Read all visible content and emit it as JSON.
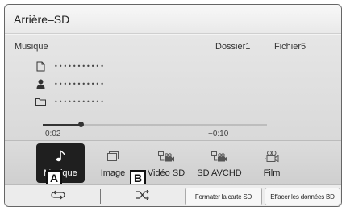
{
  "header": {
    "title": "Arrière–SD"
  },
  "track_info": {
    "source_label": "Musique",
    "folder_label": "Dossier1",
    "file_label": "Fichier5",
    "song_title": "•••••••••••",
    "artist": "•••••••••••",
    "album": "•••••••••••"
  },
  "playback": {
    "elapsed": "0:02",
    "remaining": "−0:10",
    "progress_fraction": 0.17
  },
  "source_buttons": [
    {
      "label": "Musique",
      "icon": "music-note-icon",
      "active": true
    },
    {
      "label": "Image",
      "icon": "image-icon",
      "active": false
    },
    {
      "label": "Vidéo SD",
      "icon": "video-icon",
      "active": false
    },
    {
      "label": "SD AVCHD",
      "icon": "video-icon",
      "active": false
    },
    {
      "label": "Film",
      "icon": "film-icon",
      "active": false
    }
  ],
  "callouts": {
    "a": "A",
    "b": "B"
  },
  "controls": {
    "repeat_icon": "repeat-icon",
    "shuffle_icon": "shuffle-icon",
    "format_label": "Formater la carte SD",
    "erase_label": "Effacer les données BD"
  },
  "colors": {
    "active_button": "#1f1f1f"
  }
}
